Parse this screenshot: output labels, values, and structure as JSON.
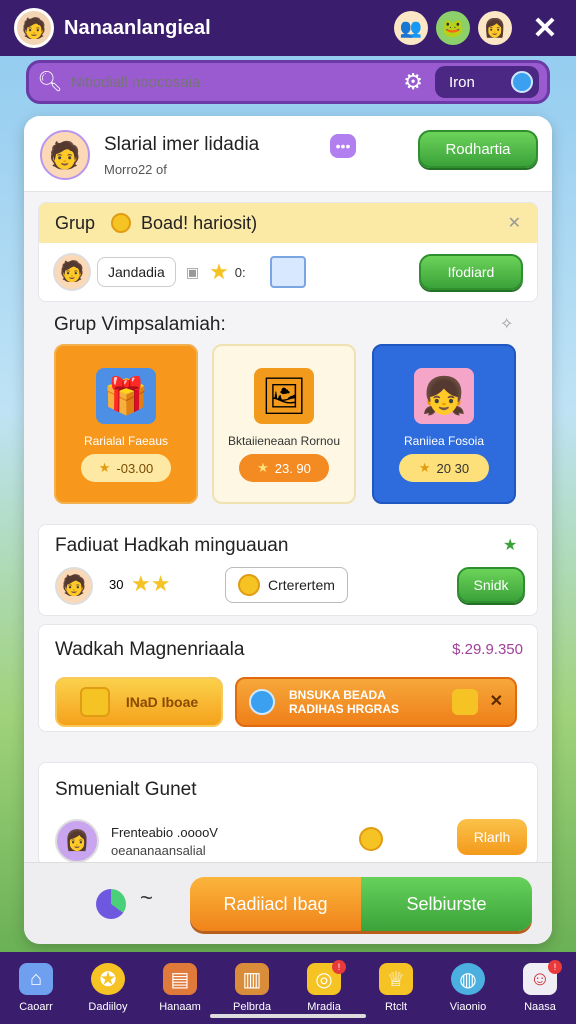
{
  "header": {
    "title": "Nanaanlangieal",
    "close_label": "✕"
  },
  "search": {
    "placeholder": "Nitiodiall noocosaia",
    "right_label": "Iron"
  },
  "profile": {
    "name": "Slarial imer lidadia",
    "sub": "Morro22 of",
    "button": "Rodhartia"
  },
  "grup": {
    "title": "Grup",
    "board": "Boad! hariosit)",
    "pill": "Jandadia",
    "count": "0:",
    "button": "Ifodiard"
  },
  "shop": {
    "title": "Grup Vimpsalamiah:",
    "cards": [
      {
        "label": "Rarialal Faeaus",
        "price": "-03.00"
      },
      {
        "label": "Bktaiieneaan Rornou",
        "price": "23. 90"
      },
      {
        "label": "Raniiea Fosoia",
        "price": "20 30"
      }
    ]
  },
  "quest": {
    "title": "Fadiuat Hadkah minguauan",
    "count": "30",
    "pill": "Crterertem",
    "button": "Snidk"
  },
  "market": {
    "title": "Wadkah Magnenriaala",
    "amount": "$.29.9.350",
    "left_btn": "INaD Iboae",
    "right_line1": "BNSUKA BEADA",
    "right_line2": "RADIHAS HRGRAS"
  },
  "friend": {
    "title": "Smuenialt Gunet",
    "line1": "Frenteabio .ooooV",
    "line2": "oeananaansalial",
    "button": "Rlarlh"
  },
  "cta": {
    "left": "Radiiacl Ibag",
    "right": "Selbiurste"
  },
  "nav": [
    {
      "label": "Caoarr",
      "icon": "home-icon"
    },
    {
      "label": "Dadiiloy",
      "icon": "compass-icon"
    },
    {
      "label": "Hanaam",
      "icon": "book-icon"
    },
    {
      "label": "Pelbrda",
      "icon": "chest-icon"
    },
    {
      "label": "Mradia",
      "icon": "coins-icon"
    },
    {
      "label": "Rtclt",
      "icon": "trophy-icon"
    },
    {
      "label": "Viaonio",
      "icon": "globe-icon"
    },
    {
      "label": "Naasa",
      "icon": "chef-icon"
    }
  ]
}
